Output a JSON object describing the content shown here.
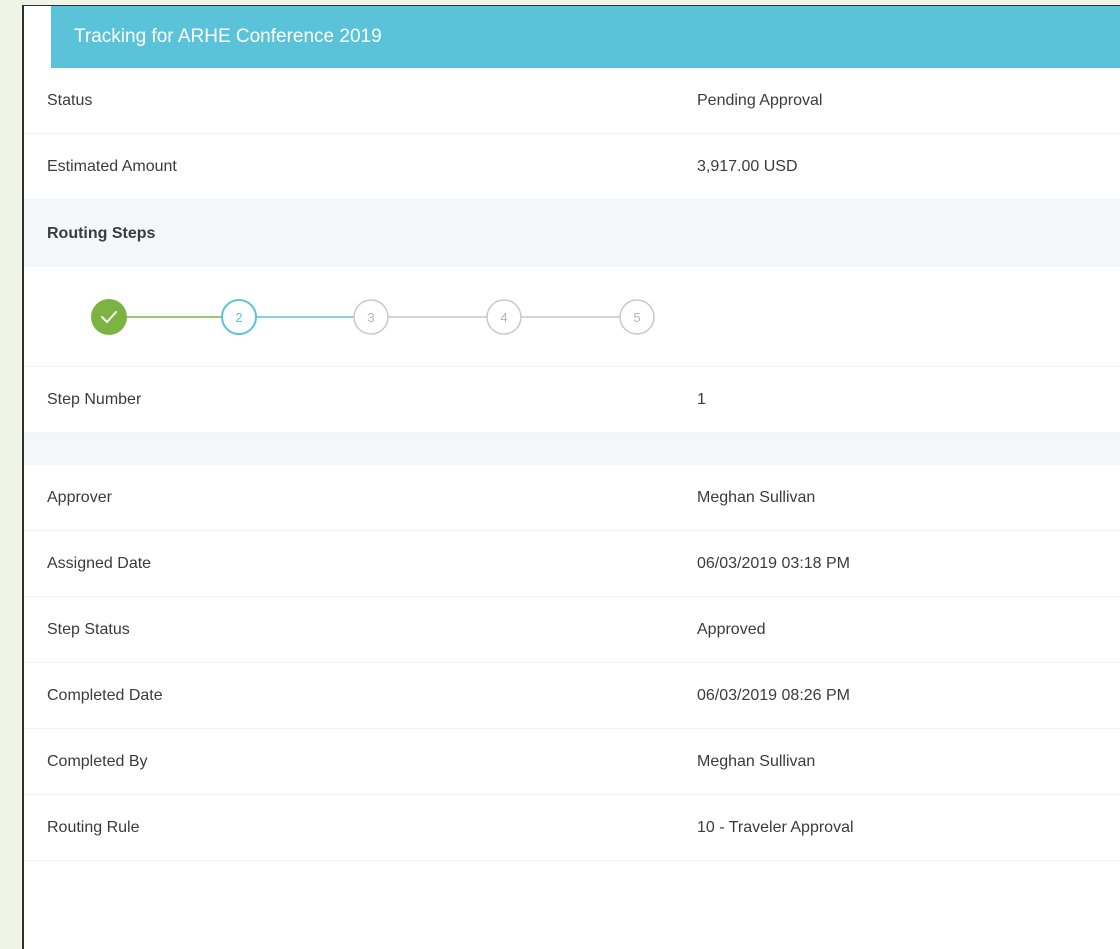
{
  "header": {
    "title": "Tracking for ARHE Conference 2019"
  },
  "summary": [
    {
      "label": "Status",
      "value": "Pending Approval"
    },
    {
      "label": "Estimated Amount",
      "value": "3,917.00 USD"
    }
  ],
  "routing": {
    "heading": "Routing Steps",
    "steps": [
      {
        "number": "1",
        "state": "completed"
      },
      {
        "number": "2",
        "state": "current"
      },
      {
        "number": "3",
        "state": "pending"
      },
      {
        "number": "4",
        "state": "pending"
      },
      {
        "number": "5",
        "state": "pending"
      }
    ],
    "step_number_label": "Step Number",
    "step_number_value": "1"
  },
  "details": [
    {
      "label": "Approver",
      "value": "Meghan Sullivan"
    },
    {
      "label": "Assigned Date",
      "value": "06/03/2019 03:18 PM"
    },
    {
      "label": "Step Status",
      "value": "Approved"
    },
    {
      "label": "Completed Date",
      "value": "06/03/2019 08:26 PM"
    },
    {
      "label": "Completed By",
      "value": "Meghan Sullivan"
    },
    {
      "label": "Routing Rule",
      "value": "10 - Traveler Approval"
    }
  ],
  "colors": {
    "header_bg": "#5bc3d9",
    "completed": "#7cb342",
    "current": "#5bc3d9",
    "pending": "#c9c9c9"
  },
  "icons": {
    "completed_step": "check-icon"
  }
}
